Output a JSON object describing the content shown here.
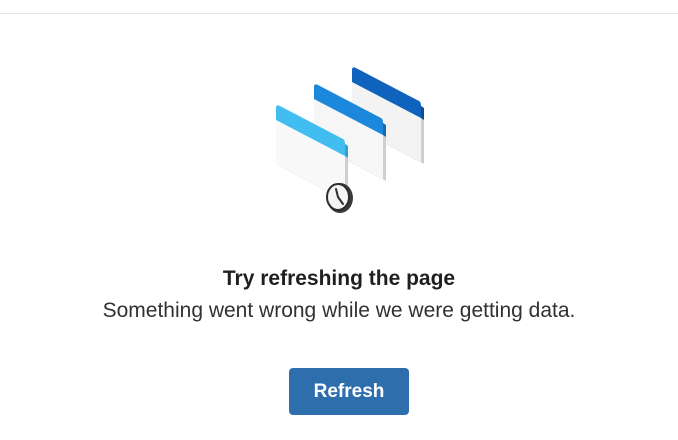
{
  "message": {
    "title": "Try refreshing the page",
    "subtitle": "Something went wrong while we were getting data."
  },
  "actions": {
    "refresh_label": "Refresh"
  },
  "colors": {
    "button": "#2f6ead",
    "card_light": "#42bdf0",
    "card_mid": "#1c88dc",
    "card_dark": "#0f63bd"
  },
  "illustration": {
    "icons": [
      "browser-window-icon",
      "clock-icon"
    ]
  }
}
